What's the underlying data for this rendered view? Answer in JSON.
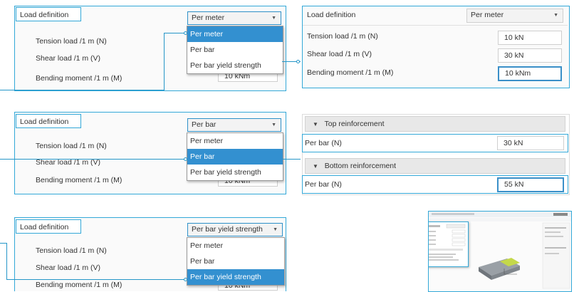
{
  "options": [
    "Per meter",
    "Per bar",
    "Per bar yield strength"
  ],
  "row1": {
    "load_definition_label": "Load definition",
    "combo_value": "Per meter",
    "tension_label": "Tension load /1 m (N)",
    "shear_label": "Shear load /1 m (V)",
    "bending_label": "Bending moment /1 m (M)",
    "bending_value_partial": "10 kNm"
  },
  "row1_right": {
    "load_definition_label": "Load definition",
    "combo_value": "Per meter",
    "tension_label": "Tension load /1 m (N)",
    "tension_value": "10 kN",
    "shear_label": "Shear load /1 m (V)",
    "shear_value": "30 kN",
    "bending_label": "Bending moment /1 m (M)",
    "bending_value": "10 kNm"
  },
  "row2": {
    "load_definition_label": "Load definition",
    "combo_value": "Per bar",
    "tension_label": "Tension load /1 m (N)",
    "shear_label": "Shear load /1 m (V)",
    "bending_label": "Bending moment /1 m (M)",
    "bending_value_partial": "10 kNm"
  },
  "row2_right": {
    "top_section": "Top reinforcement",
    "top_label": "Per bar (N)",
    "top_value": "30 kN",
    "bottom_section": "Bottom reinforcement",
    "bottom_label": "Per bar (N)",
    "bottom_value": "55 kN"
  },
  "row3": {
    "load_definition_label": "Load definition",
    "combo_value": "Per bar yield strength",
    "tension_label": "Tension load /1 m (N)",
    "shear_label": "Shear load /1 m (V)",
    "bending_label": "Bending moment /1 m (M)",
    "bending_value_partial": "10 kNm"
  },
  "colors": {
    "accent": "#33a8d8",
    "selected": "#3390d0",
    "connector": "#2596c8"
  },
  "icons": {
    "dropdown": "chevron-down-icon",
    "section_toggle": "triangle-down-icon"
  }
}
